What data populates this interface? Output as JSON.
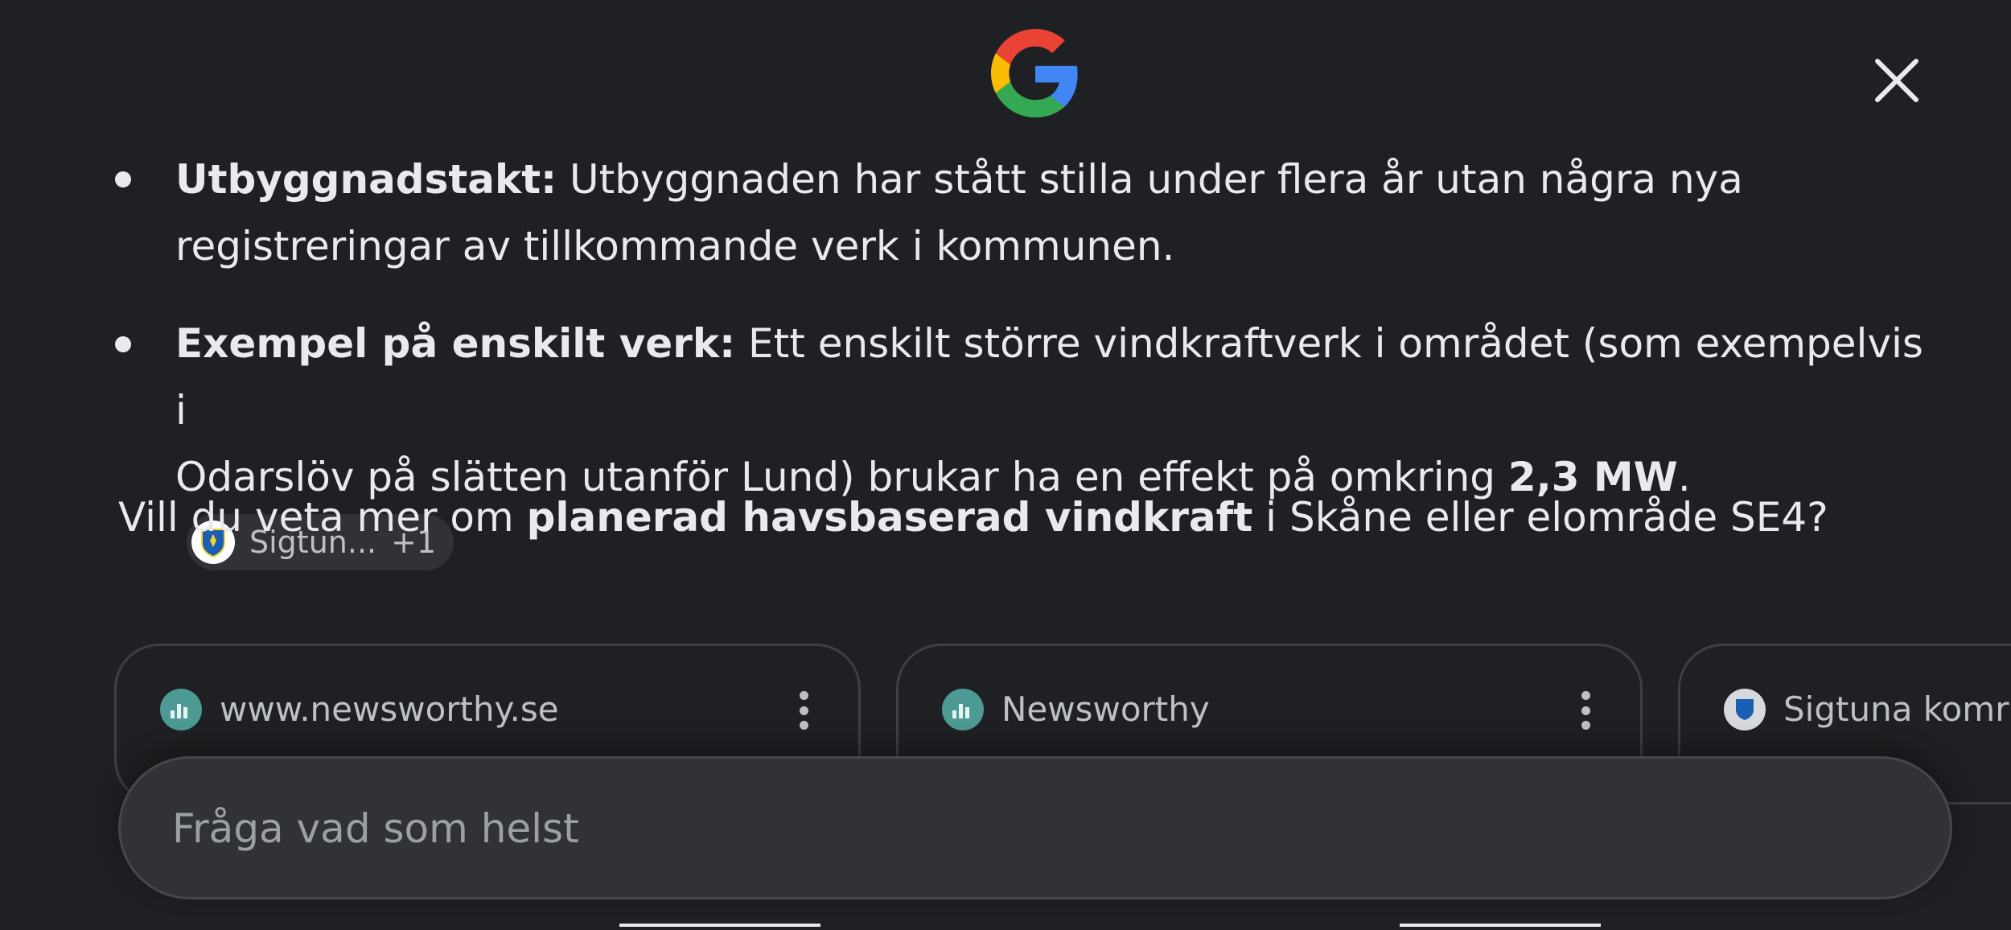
{
  "header": {
    "logo_icon": "google-g-icon",
    "close_icon": "close-icon"
  },
  "answer": {
    "bullets": [
      {
        "term": "Utbyggnadstakt:",
        "text_line1": " Utbyggnaden har stått stilla under flera år utan några nya",
        "text_line2": "registreringar av tillkommande verk i kommunen."
      },
      {
        "term": "Exempel på enskilt verk:",
        "text_line1": " Ett enskilt större vindkraftverk i området (som exempelvis i",
        "text_line2_pre": "Odarslöv på slätten utanför Lund) brukar ha en effekt på omkring ",
        "text_line2_bold": "2,3 MW",
        "text_line2_post": ".",
        "source_chip": {
          "label": "Sigtun...",
          "count": "+1",
          "icon": "sigtuna-kommun-crest-icon"
        }
      }
    ],
    "followup": {
      "pre": "Vill du veta mer om ",
      "bold": "planerad havsbaserad vindkraft",
      "post": " i Skåne eller elområde SE4?"
    }
  },
  "source_cards": [
    {
      "site": "www.newsworthy.se",
      "icon": "newsworthy-icon"
    },
    {
      "site": "Newsworthy",
      "icon": "newsworthy-icon"
    },
    {
      "site": "Sigtuna komr",
      "icon": "sigtuna-kommun-icon"
    }
  ],
  "search": {
    "placeholder": "Fråga vad som helst"
  },
  "colors": {
    "background": "#1f2023",
    "text": "#e8eaed",
    "muted": "#bdc1c6",
    "chip_bg": "#303236"
  }
}
